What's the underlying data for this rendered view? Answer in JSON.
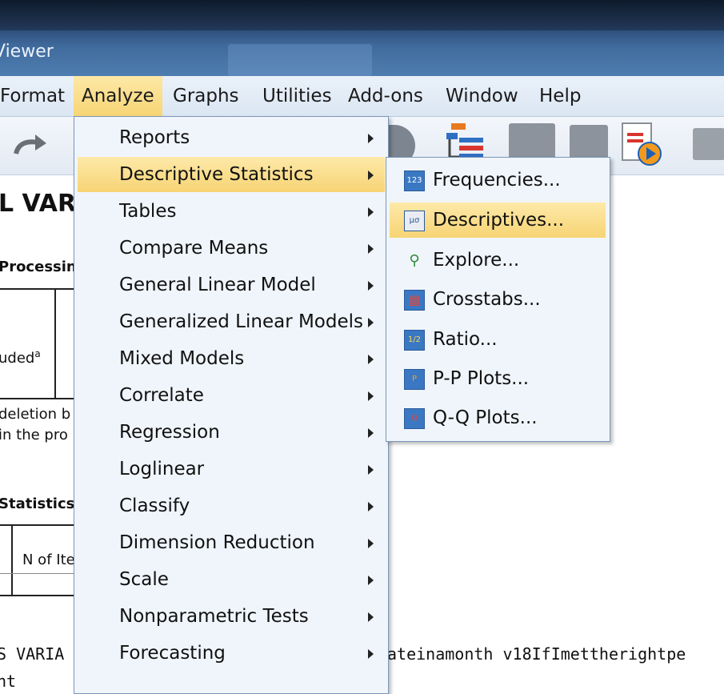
{
  "window": {
    "title": "Viewer"
  },
  "menubar": {
    "items": [
      "Format",
      "Analyze",
      "Graphs",
      "Utilities",
      "Add-ons",
      "Window",
      "Help"
    ],
    "open": "Analyze"
  },
  "background": {
    "heading": "L VAR",
    "case_processing": "Processin",
    "row1": "l",
    "row2": "uded",
    "row2_sup": "a",
    "row3": "l",
    "note1": "deletion b",
    "note2": " in the pro",
    "stats_heading": "Statistics",
    "n_items": "N of Ite",
    "syntax1_left": "S VARIA",
    "syntax1_right": "ateinamonth v18IfImettherightpe",
    "syntax2_left": "nt"
  },
  "analyze_menu": {
    "items": [
      {
        "label": "Reports",
        "has_submenu": true
      },
      {
        "label": "Descriptive Statistics",
        "has_submenu": true,
        "highlighted": true
      },
      {
        "label": "Tables",
        "has_submenu": true
      },
      {
        "label": "Compare Means",
        "has_submenu": true
      },
      {
        "label": "General Linear Model",
        "has_submenu": true
      },
      {
        "label": "Generalized Linear Models",
        "has_submenu": true
      },
      {
        "label": "Mixed Models",
        "has_submenu": true
      },
      {
        "label": "Correlate",
        "has_submenu": true
      },
      {
        "label": "Regression",
        "has_submenu": true
      },
      {
        "label": "Loglinear",
        "has_submenu": true
      },
      {
        "label": "Classify",
        "has_submenu": true
      },
      {
        "label": "Dimension Reduction",
        "has_submenu": true
      },
      {
        "label": "Scale",
        "has_submenu": true
      },
      {
        "label": "Nonparametric Tests",
        "has_submenu": true
      },
      {
        "label": "Forecasting",
        "has_submenu": true
      }
    ]
  },
  "descriptive_submenu": {
    "items": [
      {
        "label": "Frequencies...",
        "icon": "frequencies-icon",
        "glyph": "123"
      },
      {
        "label": "Descriptives...",
        "icon": "descriptives-icon",
        "glyph": "μσ",
        "highlighted": true
      },
      {
        "label": "Explore...",
        "icon": "explore-icon",
        "glyph": "⚲"
      },
      {
        "label": "Crosstabs...",
        "icon": "crosstabs-icon",
        "glyph": "▦"
      },
      {
        "label": "Ratio...",
        "icon": "ratio-icon",
        "glyph": "1/2"
      },
      {
        "label": "P-P Plots...",
        "icon": "pp-plots-icon",
        "glyph": "P"
      },
      {
        "label": "Q-Q Plots...",
        "icon": "qq-plots-icon",
        "glyph": "Q"
      }
    ]
  },
  "colors": {
    "highlight": "#f7d474",
    "menu_bg": "#f0f5fb",
    "titlebar": "#2b4a74"
  }
}
